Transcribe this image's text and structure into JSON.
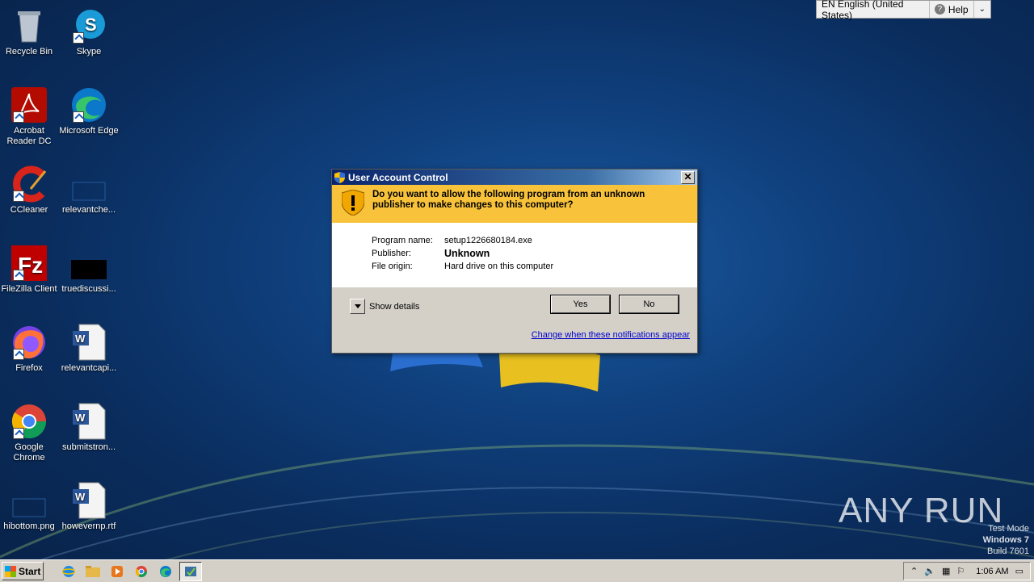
{
  "desktop": {
    "icons": [
      {
        "label": "Recycle Bin"
      },
      {
        "label": "Skype"
      },
      {
        "label": "Acrobat Reader DC"
      },
      {
        "label": "Microsoft Edge"
      },
      {
        "label": "CCleaner"
      },
      {
        "label": "relevantche..."
      },
      {
        "label": "FileZilla Client"
      },
      {
        "label": "truediscussi..."
      },
      {
        "label": "Firefox"
      },
      {
        "label": "relevantcapi..."
      },
      {
        "label": "Google Chrome"
      },
      {
        "label": "submitstron..."
      },
      {
        "label": "hibottom.png"
      },
      {
        "label": "howevernp.rtf"
      }
    ]
  },
  "langbar": {
    "language": "EN English (United States)",
    "help": "Help"
  },
  "uac": {
    "title": "User Account Control",
    "question": "Do you want to allow the following program from an unknown publisher to make changes to this computer?",
    "fields": [
      {
        "key": "Program name:",
        "value": "setup1226680184.exe"
      },
      {
        "key": "Publisher:",
        "value": "Unknown"
      },
      {
        "key": "File origin:",
        "value": "Hard drive on this computer"
      }
    ],
    "show_details": "Show details",
    "yes": "Yes",
    "no": "No",
    "link": "Change when these notifications appear"
  },
  "watermark": {
    "brand": "ANY RUN",
    "line1": "Test Mode",
    "line2": "Windows 7",
    "line3": "Build 7601"
  },
  "taskbar": {
    "start": "Start",
    "clock": "1:06 AM"
  }
}
